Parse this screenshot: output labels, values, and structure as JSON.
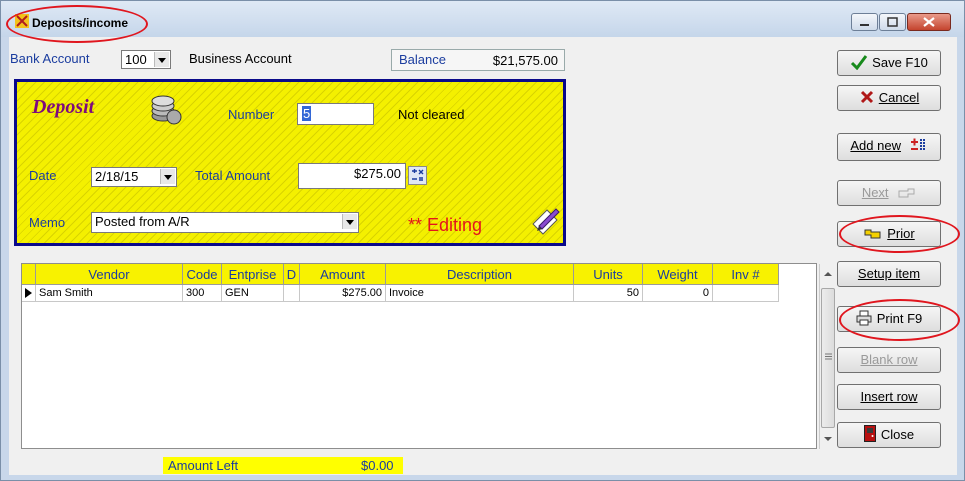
{
  "window": {
    "title": "Deposits/income",
    "controls": [
      "minimize",
      "maximize",
      "close"
    ]
  },
  "account": {
    "bank_account_label": "Bank Account",
    "bank_account_value": "100",
    "account_name": "Business Account",
    "balance_label": "Balance",
    "balance_value": "$21,575.00"
  },
  "deposit": {
    "title": "Deposit",
    "number_label": "Number",
    "number_value": "5",
    "cleared_status": "Not cleared",
    "date_label": "Date",
    "date_value": "2/18/15",
    "total_amount_label": "Total Amount",
    "total_amount_value": "$275.00",
    "memo_label": "Memo",
    "memo_value": "Posted from A/R",
    "editing_label": "** Editing"
  },
  "grid": {
    "columns": [
      "Vendor",
      "Code",
      "Entprise",
      "D",
      "Amount",
      "Description",
      "Units",
      "Weight",
      "Inv #"
    ],
    "rows": [
      [
        "Sam Smith",
        "300",
        "GEN",
        "",
        "$275.00",
        "Invoice",
        "50",
        "0",
        ""
      ]
    ]
  },
  "footer": {
    "amount_left_label": "Amount Left",
    "amount_left_value": "$0.00"
  },
  "buttons": {
    "save": "Save F10",
    "cancel": "Cancel",
    "add_new": "Add new",
    "next": "Next",
    "prior": "Prior",
    "setup_item": "Setup item",
    "print": "Print F9",
    "blank_row": "Blank row",
    "insert_row": "Insert row",
    "close": "Close"
  },
  "colors": {
    "panel_yellow": "#f4f000",
    "label_blue": "#1b3d9f",
    "title_purple": "#7d0a7d",
    "highlight_red": "#e0161e"
  }
}
